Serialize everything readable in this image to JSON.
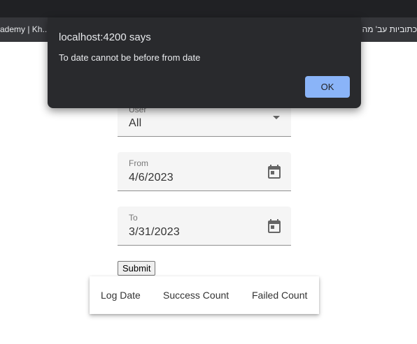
{
  "browser": {
    "bookmark_left": "ademy | Kh...",
    "bookmark_right": "כתוביות עב' מה"
  },
  "form": {
    "user_label": "User",
    "user_value": "All",
    "from_label": "From",
    "from_value": "4/6/2023",
    "to_label": "To",
    "to_value": "3/31/2023",
    "submit_label": "Submit"
  },
  "table": {
    "columns": [
      "Log Date",
      "Success Count",
      "Failed Count"
    ]
  },
  "dialog": {
    "title": "localhost:4200 says",
    "message": "To date cannot be before from date",
    "ok_label": "OK"
  },
  "colors": {
    "dialog_bg": "#292a2d",
    "ok_button": "#8ab4f8",
    "field_bg": "#f5f5f5"
  }
}
